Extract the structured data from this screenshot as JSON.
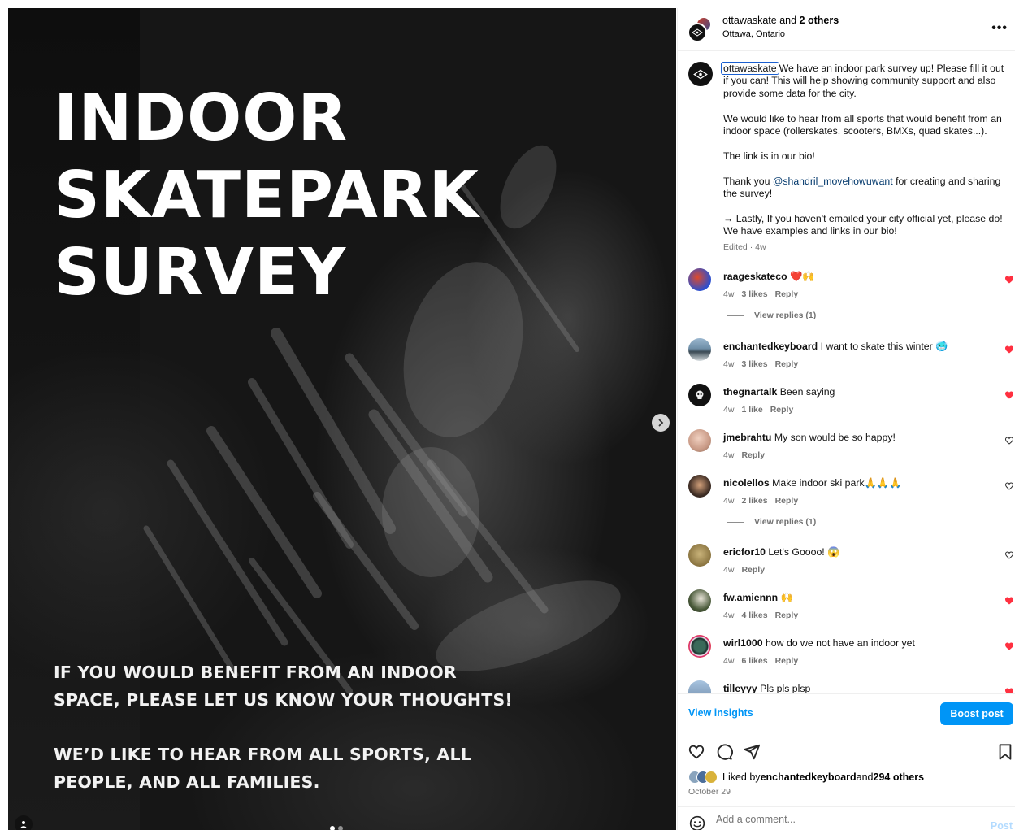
{
  "post_image": {
    "headline": [
      "INDOOR",
      "SKATEPARK",
      "SURVEY"
    ],
    "sub1": [
      "IF YOU WOULD BENEFIT FROM AN INDOOR",
      "SPACE, PLEASE LET US KNOW YOUR THOUGHTS!"
    ],
    "sub2": [
      "WE’D LIKE TO HEAR FROM ALL SPORTS, ALL",
      "PEOPLE, AND ALL FAMILIES."
    ]
  },
  "header": {
    "username": "ottawaskate",
    "and": " and ",
    "others": "2 others",
    "location": "Ottawa, Ontario",
    "more": "•••"
  },
  "caption": {
    "username": "ottawaskate",
    "p1": "We have an indoor park survey up! Please fill it out if you can! This will help showing community support and also provide some data for the city.",
    "p2": "We would like to hear from all sports that would benefit from an indoor space (rollerskates, scooters, BMXs, quad skates...).",
    "p3": "The link is in our bio!",
    "p4_pre": "Thank you ",
    "p4_mention": "@shandril_movehowuwant",
    "p4_post": " for creating and sharing the survey!",
    "p5": "→ Lastly, If you haven't emailed your city official yet, please do! We have examples and links in our bio!",
    "meta": "Edited · 4w"
  },
  "comments": [
    {
      "user": "raageskateco",
      "text": "❤️🙌",
      "time": "4w",
      "likes": "3 likes",
      "reply": "Reply",
      "liked": true,
      "replies": "View replies (1)"
    },
    {
      "user": "enchantedkeyboard",
      "text": "I want to skate this winter 🥶",
      "time": "4w",
      "likes": "3 likes",
      "reply": "Reply",
      "liked": true
    },
    {
      "user": "thegnartalk",
      "text": "Been saying",
      "time": "4w",
      "likes": "1 like",
      "reply": "Reply",
      "liked": true
    },
    {
      "user": "jmebrahtu",
      "text": "My son would be so happy!",
      "time": "4w",
      "likes": "",
      "reply": "Reply",
      "liked": false
    },
    {
      "user": "nicolellos",
      "text": "Make indoor ski park🙏🙏🙏",
      "time": "4w",
      "likes": "2 likes",
      "reply": "Reply",
      "liked": false,
      "replies": "View replies (1)"
    },
    {
      "user": "ericfor10",
      "text": "Let's Goooo! 😱",
      "time": "4w",
      "likes": "",
      "reply": "Reply",
      "liked": false
    },
    {
      "user": "fw.amiennn",
      "text": "🙌",
      "time": "4w",
      "likes": "4 likes",
      "reply": "Reply",
      "liked": true
    },
    {
      "user": "wirl1000",
      "text": "how do we not have an indoor yet",
      "time": "4w",
      "likes": "6 likes",
      "reply": "Reply",
      "liked": true
    },
    {
      "user": "tilleyyy",
      "text": "Pls pls plsp",
      "time": "",
      "likes": "",
      "reply": "",
      "liked": true
    }
  ],
  "insights": {
    "view": "View insights",
    "boost": "Boost post"
  },
  "likes": {
    "prefix": "Liked by ",
    "user": "enchantedkeyboard",
    "mid": " and ",
    "others": "294 others"
  },
  "date": "October 29",
  "add_comment": {
    "placeholder": "Add a comment...",
    "post": "Post"
  },
  "colors": {
    "accent": "#0095f6",
    "like_red": "#ff3040",
    "muted": "#737373",
    "mention": "#00376b"
  }
}
